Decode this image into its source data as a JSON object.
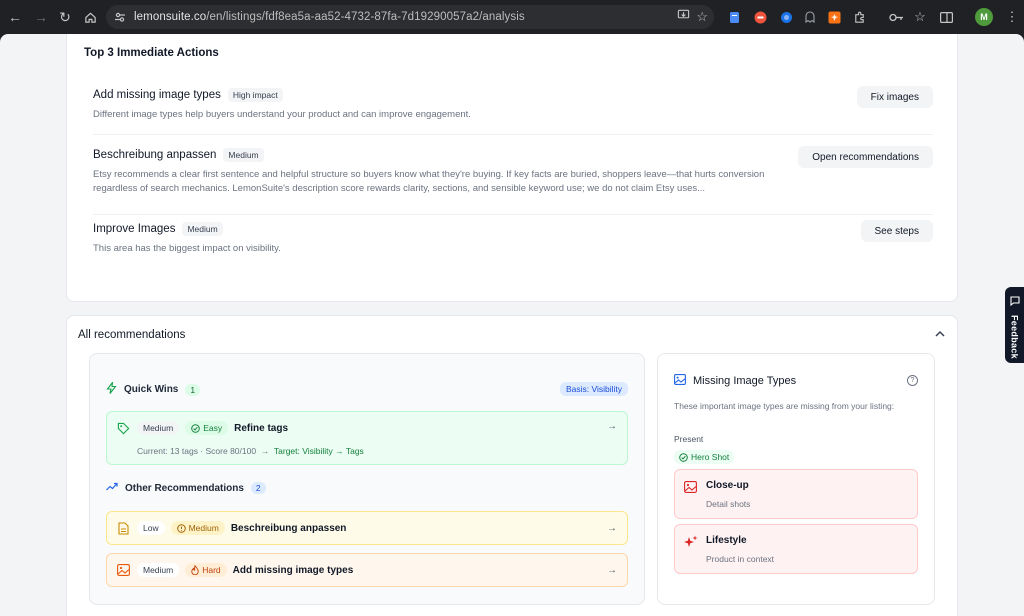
{
  "browser": {
    "url_host": "lemonsuite.co",
    "url_path": "/en/listings/fdf8ea5a-aa52-4732-87fa-7d19290057a2/analysis",
    "profile_initial": "M"
  },
  "top_actions": {
    "title": "Top 3 Immediate Actions",
    "items": [
      {
        "name": "Add missing image types",
        "badge": "High impact",
        "description": "Different image types help buyers understand your product and can improve engagement.",
        "button": "Fix images"
      },
      {
        "name": "Beschreibung anpassen",
        "badge": "Medium",
        "description": "Etsy recommends a clear first sentence and helpful structure so buyers know what they're buying. If key facts are buried, shoppers leave—that hurts conversion regardless of search mechanics. LemonSuite's description score rewards clarity, sections, and sensible keyword use; we do not claim Etsy uses...",
        "button": "Open recommendations"
      },
      {
        "name": "Improve Images",
        "badge": "Medium",
        "description": "This area has the biggest impact on visibility.",
        "button": "See steps"
      }
    ]
  },
  "all_recommendations": {
    "title": "All recommendations",
    "quick_wins": {
      "title": "Quick Wins",
      "count": "1",
      "basis": "Basis: Visibility",
      "items": [
        {
          "impact": "Medium",
          "effort": "Easy",
          "name": "Refine tags",
          "current": "Current: 13 tags · Score 80/100",
          "arrow": "→",
          "target": "Target: Visibility → Tags"
        }
      ]
    },
    "other": {
      "title": "Other Recommendations",
      "count": "2",
      "items": [
        {
          "impact": "Low",
          "effort": "Medium",
          "name": "Beschreibung anpassen"
        },
        {
          "impact": "Medium",
          "effort": "Hard",
          "name": "Add missing image types"
        }
      ]
    },
    "missing_image_types": {
      "title": "Missing Image Types",
      "description": "These important image types are missing from your listing:",
      "present_label": "Present",
      "present": [
        "Hero Shot"
      ],
      "missing": [
        {
          "name": "Close-up",
          "sub": "Detail shots"
        },
        {
          "name": "Lifestyle",
          "sub": "Product in context"
        }
      ]
    }
  },
  "feedback": {
    "label": "Feedback"
  },
  "colors": {
    "chrome": "#202124",
    "page": "#f3f4f6",
    "green": "#15803d",
    "blue": "#1d4ed8",
    "orange": "#c2410c",
    "red": "#dc2626"
  }
}
